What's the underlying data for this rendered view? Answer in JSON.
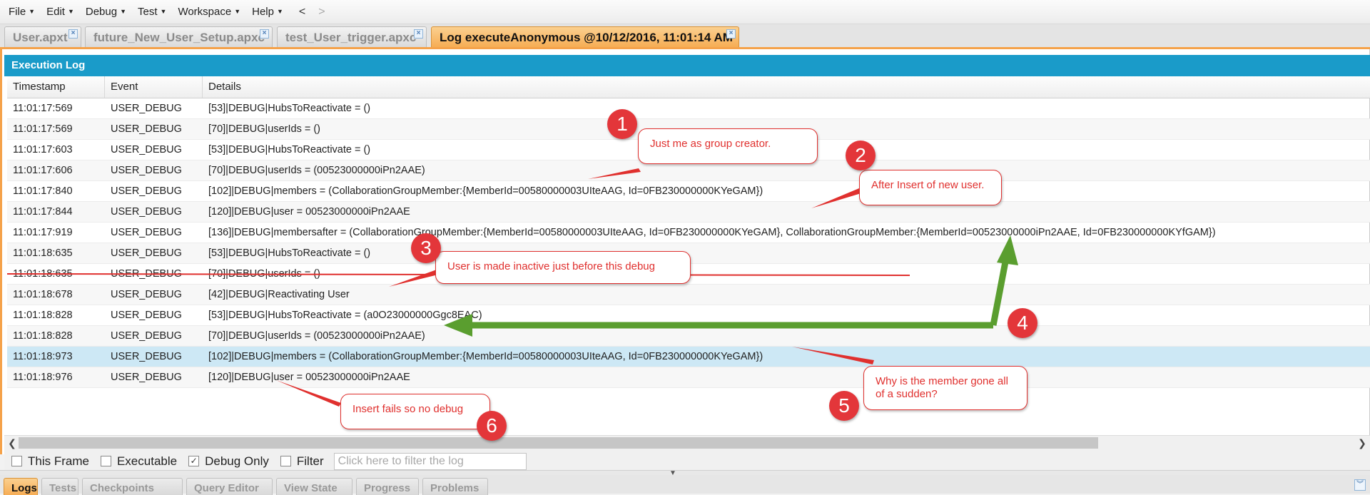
{
  "menu": {
    "items": [
      {
        "label": "File"
      },
      {
        "label": "Edit"
      },
      {
        "label": "Debug"
      },
      {
        "label": "Test"
      },
      {
        "label": "Workspace"
      },
      {
        "label": "Help"
      }
    ],
    "back": "<",
    "forward": ">"
  },
  "tabs": [
    {
      "label": "User.apxt"
    },
    {
      "label": "future_New_User_Setup.apxc"
    },
    {
      "label": "test_User_trigger.apxc"
    },
    {
      "label": "Log executeAnonymous @10/12/2016, 11:01:14 AM"
    }
  ],
  "panel": {
    "title": "Execution Log",
    "columns": [
      "Timestamp",
      "Event",
      "Details"
    ],
    "rows": [
      {
        "timestamp": "11:01:17:569",
        "event": "USER_DEBUG",
        "details": "[53]|DEBUG|HubsToReactivate = ()"
      },
      {
        "timestamp": "11:01:17:569",
        "event": "USER_DEBUG",
        "details": "[70]|DEBUG|userIds = ()"
      },
      {
        "timestamp": "11:01:17:603",
        "event": "USER_DEBUG",
        "details": "[53]|DEBUG|HubsToReactivate = ()"
      },
      {
        "timestamp": "11:01:17:606",
        "event": "USER_DEBUG",
        "details": "[70]|DEBUG|userIds = (00523000000iPn2AAE)"
      },
      {
        "timestamp": "11:01:17:840",
        "event": "USER_DEBUG",
        "details": "[102]|DEBUG|members = (CollaborationGroupMember:{MemberId=00580000003UIteAAG, Id=0FB230000000KYeGAM})"
      },
      {
        "timestamp": "11:01:17:844",
        "event": "USER_DEBUG",
        "details": "[120]|DEBUG|user = 00523000000iPn2AAE"
      },
      {
        "timestamp": "11:01:17:919",
        "event": "USER_DEBUG",
        "details": "[136]|DEBUG|membersafter = (CollaborationGroupMember:{MemberId=00580000003UIteAAG, Id=0FB230000000KYeGAM}, CollaborationGroupMember:{MemberId=00523000000iPn2AAE, Id=0FB230000000KYfGAM})"
      },
      {
        "timestamp": "11:01:18:635",
        "event": "USER_DEBUG",
        "details": "[53]|DEBUG|HubsToReactivate = ()"
      },
      {
        "timestamp": "11:01:18:635",
        "event": "USER_DEBUG",
        "details": "[70]|DEBUG|userIds = ()"
      },
      {
        "timestamp": "11:01:18:678",
        "event": "USER_DEBUG",
        "details": "[42]|DEBUG|Reactivating User"
      },
      {
        "timestamp": "11:01:18:828",
        "event": "USER_DEBUG",
        "details": "[53]|DEBUG|HubsToReactivate = (a0O23000000Ggc8EAC)"
      },
      {
        "timestamp": "11:01:18:828",
        "event": "USER_DEBUG",
        "details": "[70]|DEBUG|userIds = (00523000000iPn2AAE)"
      },
      {
        "timestamp": "11:01:18:973",
        "event": "USER_DEBUG",
        "details": "[102]|DEBUG|members = (CollaborationGroupMember:{MemberId=00580000003UIteAAG, Id=0FB230000000KYeGAM})"
      },
      {
        "timestamp": "11:01:18:976",
        "event": "USER_DEBUG",
        "details": "[120]|DEBUG|user = 00523000000iPn2AAE"
      }
    ],
    "selected_row": 12
  },
  "filters": {
    "this_frame": {
      "label": "This Frame",
      "checked": false
    },
    "executable": {
      "label": "Executable",
      "checked": false
    },
    "debug_only": {
      "label": "Debug Only",
      "checked": true
    },
    "filter": {
      "label": "Filter",
      "checked": false
    },
    "filter_placeholder": "Click here to filter the log"
  },
  "bottom_tabs": [
    {
      "label": "Logs"
    },
    {
      "label": "Tests"
    },
    {
      "label": "Checkpoints"
    },
    {
      "label": "Query Editor"
    },
    {
      "label": "View State"
    },
    {
      "label": "Progress"
    },
    {
      "label": "Problems"
    }
  ],
  "annotations": {
    "colors": {
      "callout": "#e0302e",
      "arrow_green": "#5a9e2f"
    },
    "callouts": [
      {
        "badge": "1",
        "text": "Just me as group creator."
      },
      {
        "badge": "2",
        "text": "After Insert of new user."
      },
      {
        "badge": "3",
        "text": "User is made inactive just before this debug"
      },
      {
        "badge": "4",
        "text": ""
      },
      {
        "badge": "5",
        "text": "Why is the member gone all of a sudden?"
      },
      {
        "badge": "6",
        "text": "Insert fails so no debug"
      }
    ]
  }
}
